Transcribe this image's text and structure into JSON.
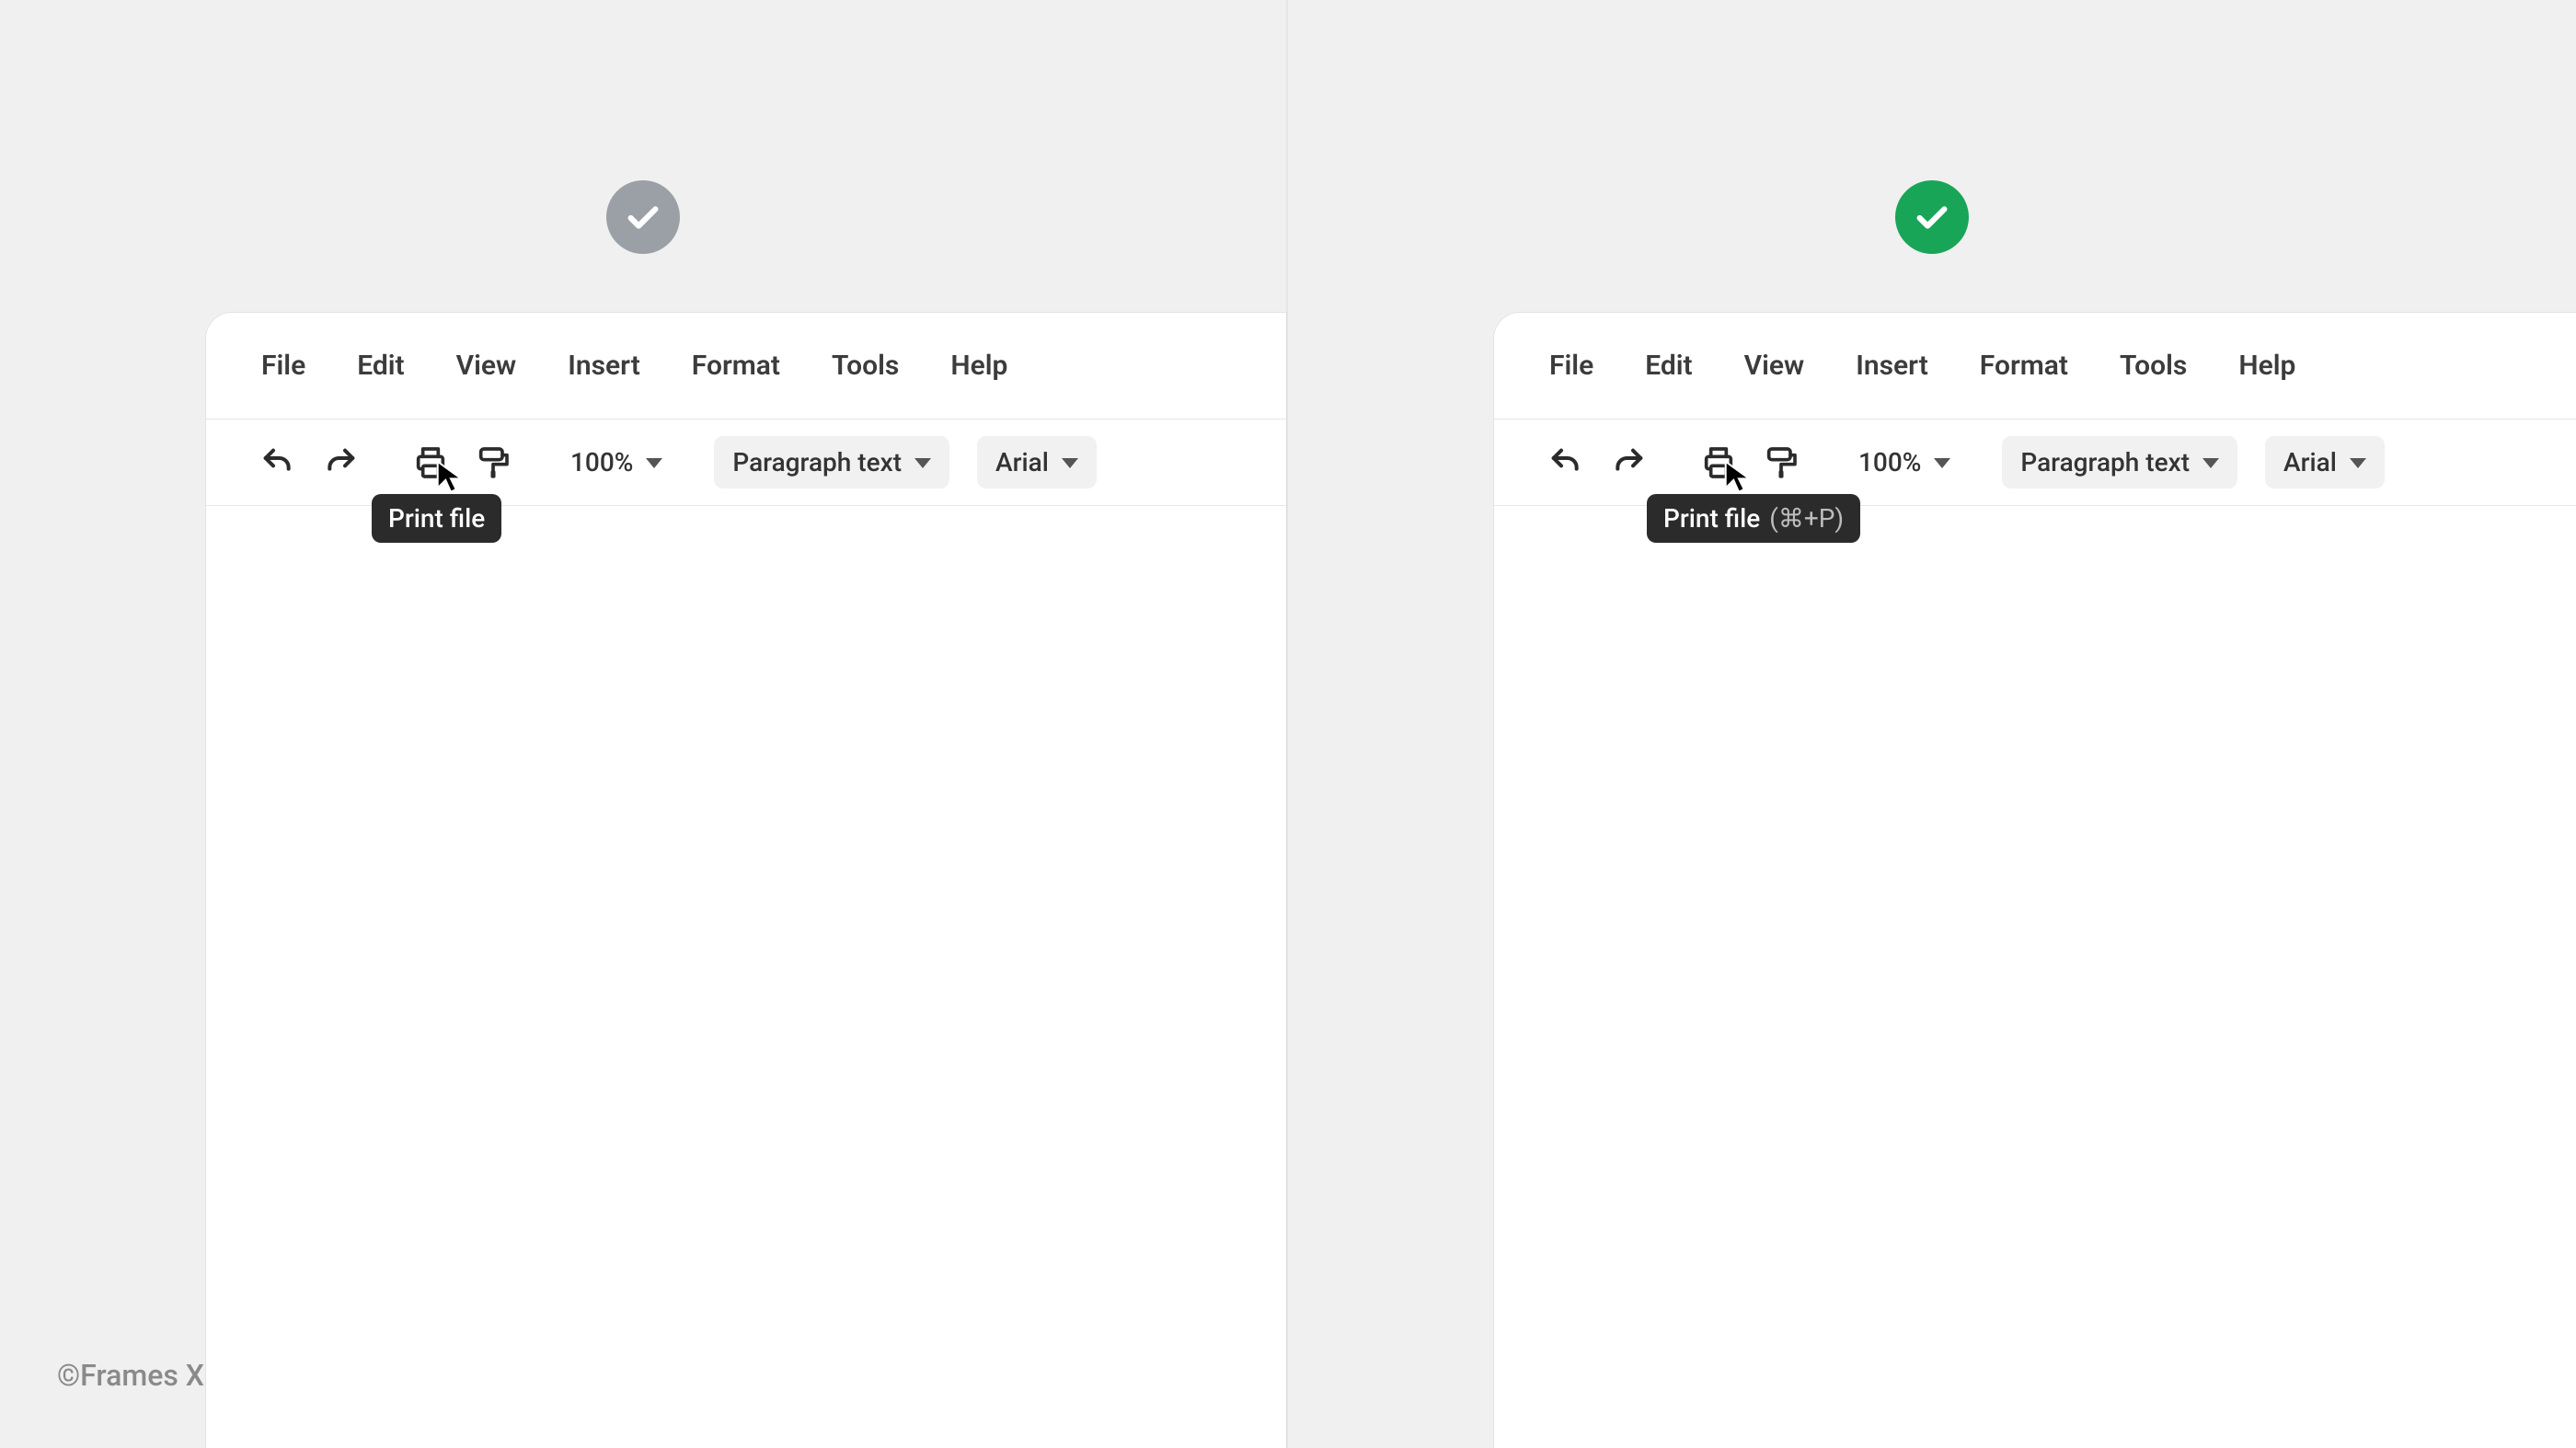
{
  "credit": "©Frames X",
  "badge_left": {
    "icon": "check-icon",
    "color": "grey"
  },
  "badge_right": {
    "icon": "check-icon",
    "color": "green"
  },
  "menu": {
    "items": [
      "File",
      "Edit",
      "View",
      "Insert",
      "Format",
      "Tools",
      "Help"
    ]
  },
  "toolbar": {
    "undo_icon": "undo-icon",
    "redo_icon": "redo-icon",
    "print_icon": "print-icon",
    "format_paint_icon": "paint-roller-icon",
    "zoom_label": "100%",
    "style_label": "Paragraph text",
    "font_label": "Arial"
  },
  "tooltip_left": {
    "text": "Print file",
    "shortcut": ""
  },
  "tooltip_right": {
    "text": "Print file",
    "shortcut": "(⌘+P)"
  }
}
